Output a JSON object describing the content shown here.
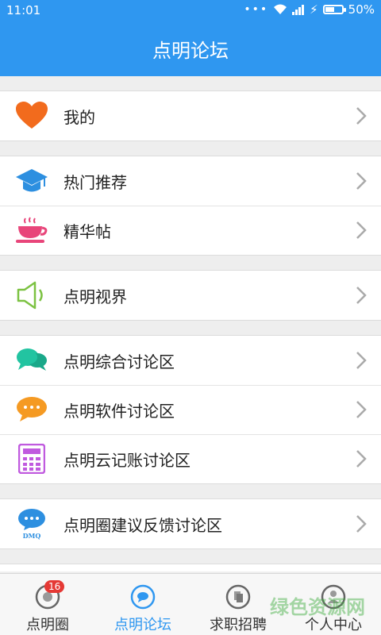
{
  "status": {
    "time": "11:01",
    "battery": "50%",
    "battery_level": 0.5
  },
  "header": {
    "title": "点明论坛"
  },
  "groups": [
    {
      "items": [
        {
          "label": "我的",
          "icon": "heart-icon"
        }
      ]
    },
    {
      "items": [
        {
          "label": "热门推荐",
          "icon": "graduation-cap-icon"
        },
        {
          "label": "精华帖",
          "icon": "coffee-cup-icon"
        }
      ]
    },
    {
      "items": [
        {
          "label": "点明视界",
          "icon": "speaker-icon"
        }
      ]
    },
    {
      "items": [
        {
          "label": "点明综合讨论区",
          "icon": "chat-bubbles-icon"
        },
        {
          "label": "点明软件讨论区",
          "icon": "chat-bubble-dots-icon"
        },
        {
          "label": "点明云记账讨论区",
          "icon": "calculator-icon"
        }
      ]
    },
    {
      "items": [
        {
          "label": "点明圈建议反馈讨论区",
          "icon": "dmq-bubble-icon",
          "icon_text": "DMQ"
        }
      ]
    }
  ],
  "tabs": [
    {
      "label": "点明圈",
      "badge": "16"
    },
    {
      "label": "点明论坛",
      "active": true
    },
    {
      "label": "求职招聘"
    },
    {
      "label": "个人中心"
    }
  ],
  "watermark": "绿色资源网",
  "colors": {
    "primary": "#2f97f0",
    "heart": "#f26b1d",
    "cap": "#2d8fe0",
    "cup": "#e8457a",
    "speaker": "#7cc242",
    "chat": "#22c4a1",
    "chat_orange": "#f59a23",
    "calculator": "#c05adf"
  }
}
